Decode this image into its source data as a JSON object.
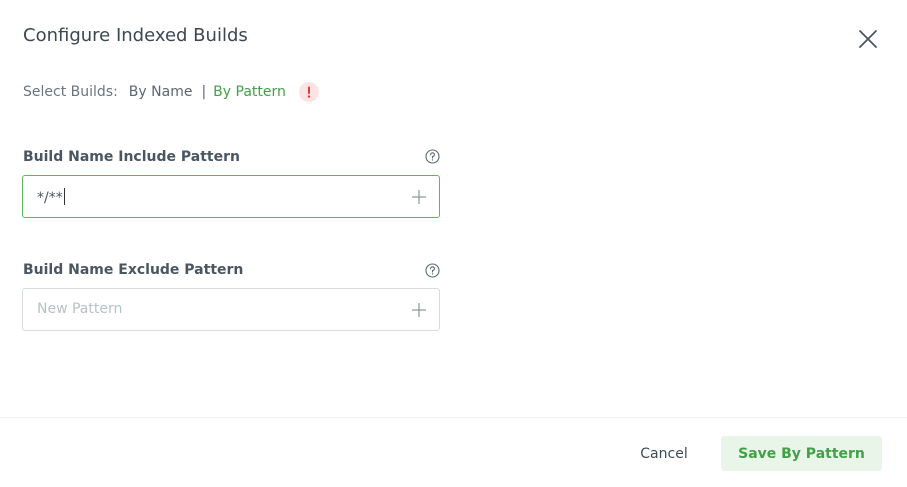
{
  "dialog": {
    "title": "Configure Indexed Builds",
    "close_icon": "close-icon"
  },
  "selector": {
    "label": "Select Builds:",
    "options": [
      "By Name",
      "By Pattern"
    ],
    "separator": "|",
    "selected": "By Pattern",
    "warning_icon": "exclamation-icon"
  },
  "include": {
    "label": "Build Name Include Pattern",
    "value": "*/**",
    "help_icon": "question-circle-icon",
    "add_icon": "plus-icon"
  },
  "exclude": {
    "label": "Build Name Exclude Pattern",
    "value": "",
    "placeholder": "New Pattern",
    "help_icon": "question-circle-icon",
    "add_icon": "plus-icon"
  },
  "footer": {
    "cancel_label": "Cancel",
    "save_label": "Save By Pattern"
  },
  "colors": {
    "accent": "#43a047",
    "active_border": "#5cb85c",
    "warning_bg": "#fde4e4",
    "warning_fg": "#e53935",
    "save_bg": "#e9f5e9"
  }
}
